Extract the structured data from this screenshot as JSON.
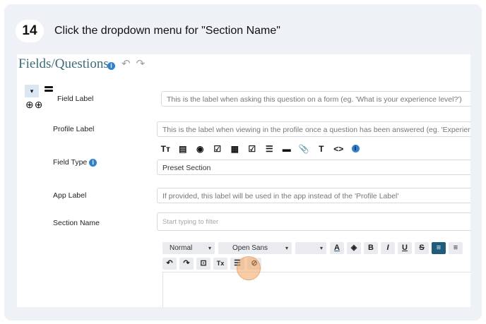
{
  "step": {
    "number": "14",
    "instruction": "Click the dropdown menu for \"Section Name\""
  },
  "section": {
    "title": "Fields/Questions",
    "info_glyph": "i",
    "undo_glyph": "↶",
    "redo_glyph": "↷"
  },
  "row_controls": {
    "caret": "▾",
    "icons": "⊕⊕"
  },
  "fields": {
    "field_label": {
      "label": "Field Label",
      "placeholder": "This is the label when asking this question on a form (eg. 'What is your experience level?')"
    },
    "profile_label": {
      "label": "Profile Label",
      "placeholder": "This is the label when viewing in the profile once a question has been answered (eg. 'Experien"
    },
    "field_type": {
      "label": "Field Type",
      "value": "Preset Section",
      "icons": [
        "Tт",
        "▤",
        "◉",
        "☑",
        "▦",
        "☑",
        "☰",
        "▬",
        "📎",
        "T",
        "<>"
      ]
    },
    "app_label": {
      "label": "App Label",
      "placeholder": "If provided, this label will be used in the app instead of the 'Profile Label'"
    },
    "section_name": {
      "label": "Section Name",
      "placeholder": "Start typing to filter"
    }
  },
  "editor": {
    "paragraph_select": "Normal",
    "font_select": "Open Sans",
    "size_select": "",
    "caret": "▾",
    "buttons_row1": [
      "A",
      "◈",
      "B",
      "I",
      "U",
      "S",
      "≡",
      "≡"
    ],
    "buttons_row2": [
      "↶",
      "↷",
      "⊡",
      "Tx",
      "☰",
      "⊘"
    ]
  },
  "colors": {
    "accent": "#1f5b7a",
    "title": "#3d6b7c",
    "info": "#2f80d1",
    "click_marker": "#f4a460"
  }
}
